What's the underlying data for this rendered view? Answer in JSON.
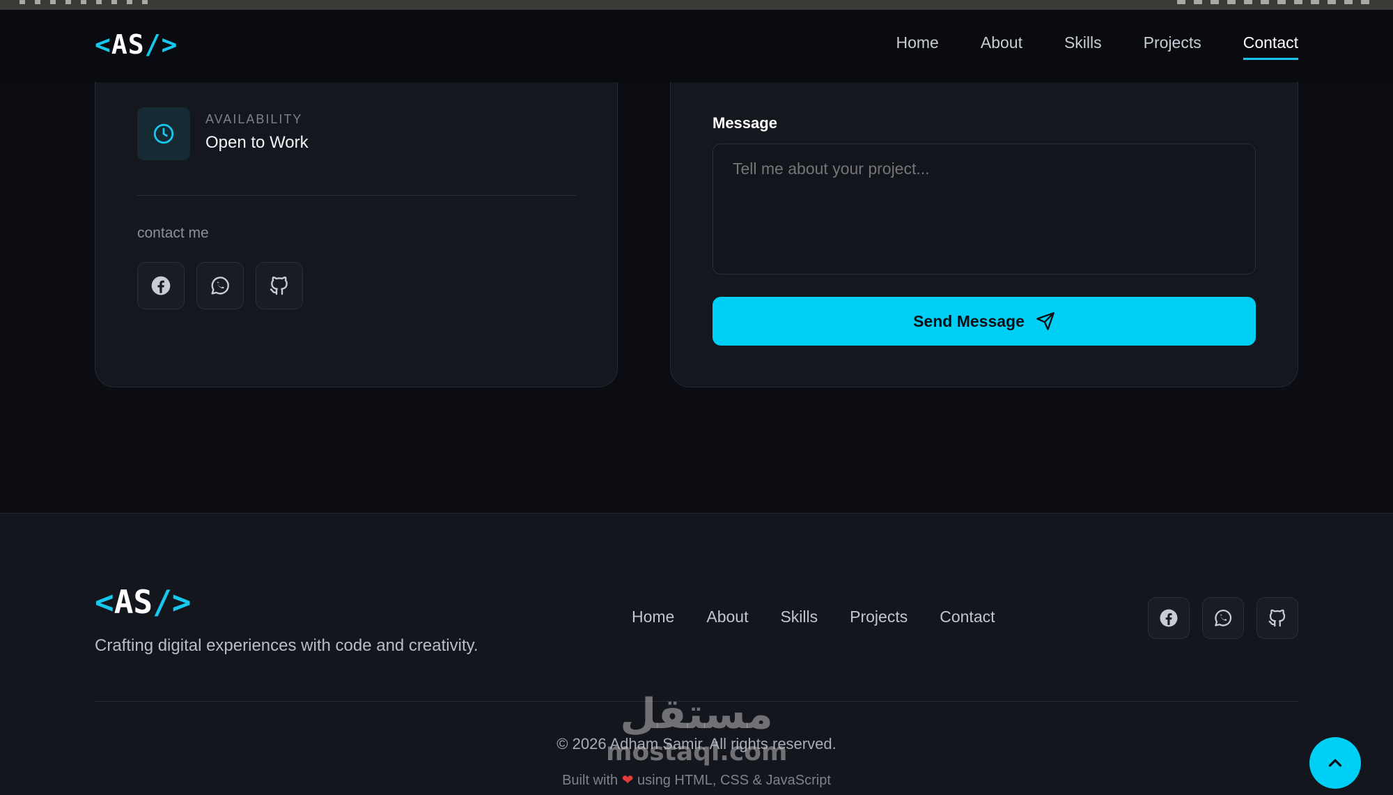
{
  "brand": {
    "logo_open": "<",
    "logo_text": "AS",
    "logo_close": "/>"
  },
  "nav": {
    "items": [
      {
        "label": "Home"
      },
      {
        "label": "About"
      },
      {
        "label": "Skills"
      },
      {
        "label": "Projects"
      },
      {
        "label": "Contact"
      }
    ],
    "active": "Contact"
  },
  "contact_info": {
    "availability_label": "AVAILABILITY",
    "availability_value": "Open to Work",
    "contact_me_label": "contact me",
    "socials": [
      "facebook-icon",
      "whatsapp-icon",
      "github-icon"
    ]
  },
  "form": {
    "message_label": "Message",
    "message_placeholder": "Tell me about your project...",
    "send_label": "Send Message"
  },
  "footer": {
    "tagline": "Crafting digital experiences with code and creativity.",
    "links": [
      {
        "label": "Home"
      },
      {
        "label": "About"
      },
      {
        "label": "Skills"
      },
      {
        "label": "Projects"
      },
      {
        "label": "Contact"
      }
    ],
    "copyright": "© 2026 Adham Samir. All rights reserved.",
    "built_prefix": "Built with",
    "built_suffix": "using HTML, CSS & JavaScript"
  },
  "watermark": {
    "arabic": "مستقل",
    "latin": "mostaql.com"
  },
  "colors": {
    "accent": "#00cff5",
    "background": "#0b0d12",
    "card": "#15171e",
    "heart": "#e53b3b"
  }
}
